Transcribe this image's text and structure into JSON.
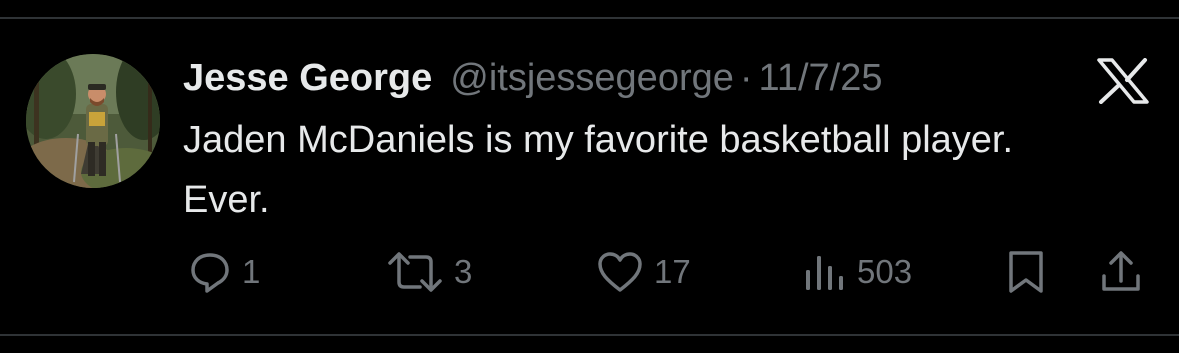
{
  "tweet": {
    "author": {
      "display_name": "Jesse George",
      "handle": "@itsjessegeorge",
      "avatar_icon": "hiker-avatar"
    },
    "separator": "·",
    "date": "11/7/25",
    "text": "Jaden McDaniels is my favorite basketball player. Ever.",
    "platform_icon": "x-logo-icon"
  },
  "actions": {
    "replies": "1",
    "reposts": "3",
    "likes": "17",
    "views": "503",
    "icons": [
      "reply-icon",
      "repost-icon",
      "like-icon",
      "views-icon",
      "bookmark-icon",
      "share-icon"
    ]
  },
  "colors": {
    "background": "#000000",
    "text_primary": "#e7e9ea",
    "text_secondary": "#71767b",
    "divider": "#2f3336"
  }
}
